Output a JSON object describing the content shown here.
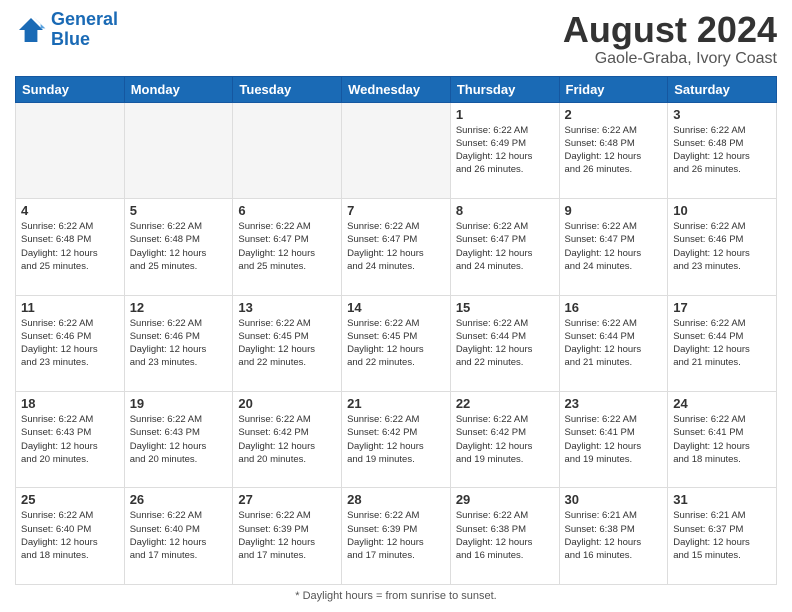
{
  "header": {
    "logo_line1": "General",
    "logo_line2": "Blue",
    "title": "August 2024",
    "subtitle": "Gaole-Graba, Ivory Coast"
  },
  "footer": {
    "note": "Daylight hours"
  },
  "days_of_week": [
    "Sunday",
    "Monday",
    "Tuesday",
    "Wednesday",
    "Thursday",
    "Friday",
    "Saturday"
  ],
  "weeks": [
    [
      {
        "day": "",
        "info": ""
      },
      {
        "day": "",
        "info": ""
      },
      {
        "day": "",
        "info": ""
      },
      {
        "day": "",
        "info": ""
      },
      {
        "day": "1",
        "info": "Sunrise: 6:22 AM\nSunset: 6:49 PM\nDaylight: 12 hours\nand 26 minutes."
      },
      {
        "day": "2",
        "info": "Sunrise: 6:22 AM\nSunset: 6:48 PM\nDaylight: 12 hours\nand 26 minutes."
      },
      {
        "day": "3",
        "info": "Sunrise: 6:22 AM\nSunset: 6:48 PM\nDaylight: 12 hours\nand 26 minutes."
      }
    ],
    [
      {
        "day": "4",
        "info": "Sunrise: 6:22 AM\nSunset: 6:48 PM\nDaylight: 12 hours\nand 25 minutes."
      },
      {
        "day": "5",
        "info": "Sunrise: 6:22 AM\nSunset: 6:48 PM\nDaylight: 12 hours\nand 25 minutes."
      },
      {
        "day": "6",
        "info": "Sunrise: 6:22 AM\nSunset: 6:47 PM\nDaylight: 12 hours\nand 25 minutes."
      },
      {
        "day": "7",
        "info": "Sunrise: 6:22 AM\nSunset: 6:47 PM\nDaylight: 12 hours\nand 24 minutes."
      },
      {
        "day": "8",
        "info": "Sunrise: 6:22 AM\nSunset: 6:47 PM\nDaylight: 12 hours\nand 24 minutes."
      },
      {
        "day": "9",
        "info": "Sunrise: 6:22 AM\nSunset: 6:47 PM\nDaylight: 12 hours\nand 24 minutes."
      },
      {
        "day": "10",
        "info": "Sunrise: 6:22 AM\nSunset: 6:46 PM\nDaylight: 12 hours\nand 23 minutes."
      }
    ],
    [
      {
        "day": "11",
        "info": "Sunrise: 6:22 AM\nSunset: 6:46 PM\nDaylight: 12 hours\nand 23 minutes."
      },
      {
        "day": "12",
        "info": "Sunrise: 6:22 AM\nSunset: 6:46 PM\nDaylight: 12 hours\nand 23 minutes."
      },
      {
        "day": "13",
        "info": "Sunrise: 6:22 AM\nSunset: 6:45 PM\nDaylight: 12 hours\nand 22 minutes."
      },
      {
        "day": "14",
        "info": "Sunrise: 6:22 AM\nSunset: 6:45 PM\nDaylight: 12 hours\nand 22 minutes."
      },
      {
        "day": "15",
        "info": "Sunrise: 6:22 AM\nSunset: 6:44 PM\nDaylight: 12 hours\nand 22 minutes."
      },
      {
        "day": "16",
        "info": "Sunrise: 6:22 AM\nSunset: 6:44 PM\nDaylight: 12 hours\nand 21 minutes."
      },
      {
        "day": "17",
        "info": "Sunrise: 6:22 AM\nSunset: 6:44 PM\nDaylight: 12 hours\nand 21 minutes."
      }
    ],
    [
      {
        "day": "18",
        "info": "Sunrise: 6:22 AM\nSunset: 6:43 PM\nDaylight: 12 hours\nand 20 minutes."
      },
      {
        "day": "19",
        "info": "Sunrise: 6:22 AM\nSunset: 6:43 PM\nDaylight: 12 hours\nand 20 minutes."
      },
      {
        "day": "20",
        "info": "Sunrise: 6:22 AM\nSunset: 6:42 PM\nDaylight: 12 hours\nand 20 minutes."
      },
      {
        "day": "21",
        "info": "Sunrise: 6:22 AM\nSunset: 6:42 PM\nDaylight: 12 hours\nand 19 minutes."
      },
      {
        "day": "22",
        "info": "Sunrise: 6:22 AM\nSunset: 6:42 PM\nDaylight: 12 hours\nand 19 minutes."
      },
      {
        "day": "23",
        "info": "Sunrise: 6:22 AM\nSunset: 6:41 PM\nDaylight: 12 hours\nand 19 minutes."
      },
      {
        "day": "24",
        "info": "Sunrise: 6:22 AM\nSunset: 6:41 PM\nDaylight: 12 hours\nand 18 minutes."
      }
    ],
    [
      {
        "day": "25",
        "info": "Sunrise: 6:22 AM\nSunset: 6:40 PM\nDaylight: 12 hours\nand 18 minutes."
      },
      {
        "day": "26",
        "info": "Sunrise: 6:22 AM\nSunset: 6:40 PM\nDaylight: 12 hours\nand 17 minutes."
      },
      {
        "day": "27",
        "info": "Sunrise: 6:22 AM\nSunset: 6:39 PM\nDaylight: 12 hours\nand 17 minutes."
      },
      {
        "day": "28",
        "info": "Sunrise: 6:22 AM\nSunset: 6:39 PM\nDaylight: 12 hours\nand 17 minutes."
      },
      {
        "day": "29",
        "info": "Sunrise: 6:22 AM\nSunset: 6:38 PM\nDaylight: 12 hours\nand 16 minutes."
      },
      {
        "day": "30",
        "info": "Sunrise: 6:21 AM\nSunset: 6:38 PM\nDaylight: 12 hours\nand 16 minutes."
      },
      {
        "day": "31",
        "info": "Sunrise: 6:21 AM\nSunset: 6:37 PM\nDaylight: 12 hours\nand 15 minutes."
      }
    ]
  ]
}
